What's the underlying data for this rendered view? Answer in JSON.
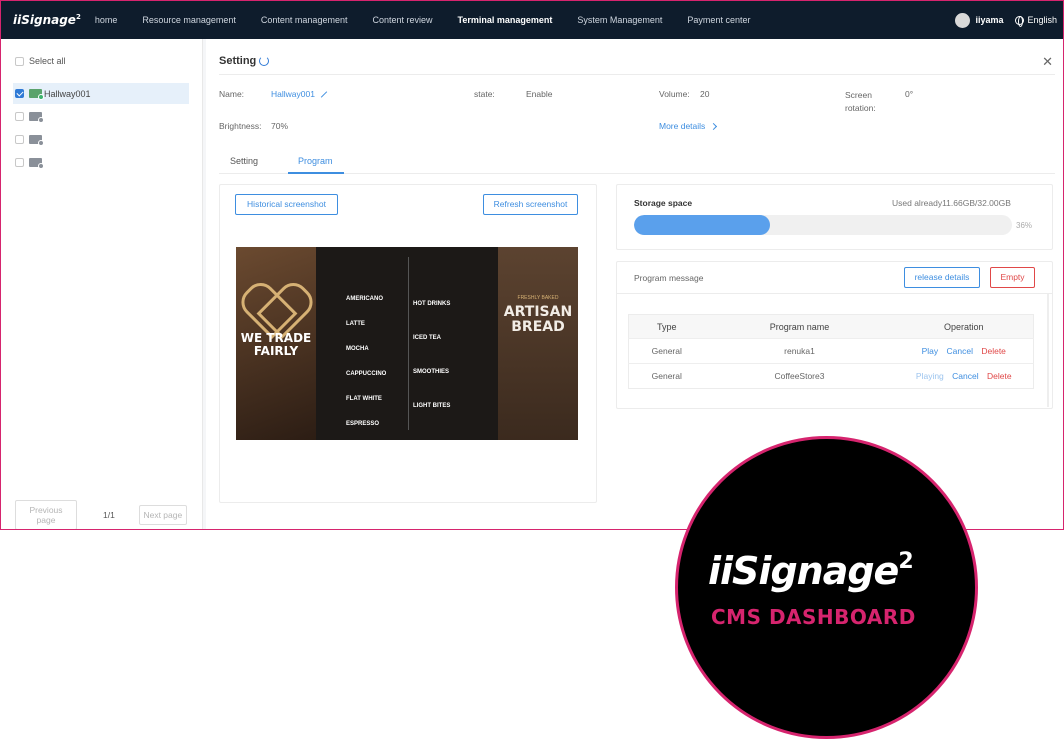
{
  "header": {
    "logo": "iiSignage",
    "logo_sup": "2",
    "nav": [
      {
        "label": "home",
        "active": false
      },
      {
        "label": "Resource management",
        "active": false
      },
      {
        "label": "Content management",
        "active": false
      },
      {
        "label": "Content review",
        "active": false
      },
      {
        "label": "Terminal management",
        "active": true
      },
      {
        "label": "System Management",
        "active": false
      },
      {
        "label": "Payment center",
        "active": false
      }
    ],
    "user": "iiyama",
    "language": "English"
  },
  "sidebar": {
    "select_all": "Select all",
    "terminals": [
      {
        "name": "Hallway001",
        "checked": true,
        "online": true
      },
      {
        "name": "",
        "checked": false,
        "online": false
      },
      {
        "name": "",
        "checked": false,
        "online": false
      },
      {
        "name": "",
        "checked": false,
        "online": false
      }
    ],
    "pager": {
      "prev": "Previous page",
      "page": "1/1",
      "next": "Next page"
    }
  },
  "detail": {
    "title": "Setting",
    "name_label": "Name:",
    "name_value": "Hallway001",
    "state_label": "state:",
    "state_value": "Enable",
    "volume_label": "Volume:",
    "volume_value": "20",
    "rotation_label": "Screen rotation:",
    "rotation_value": "0°",
    "brightness_label": "Brightness:",
    "brightness_value": "70%",
    "more_details": "More details",
    "tabs": [
      {
        "label": "Setting",
        "active": false
      },
      {
        "label": "Program",
        "active": true
      }
    ]
  },
  "screenshot": {
    "historical": "Historical screenshot",
    "refresh": "Refresh screenshot",
    "preview": {
      "left_text": "WE TRADE FAIRLY",
      "menu_col1": [
        "AMERICANO",
        "LATTE",
        "MOCHA",
        "CAPPUCCINO",
        "FLAT WHITE",
        "ESPRESSO"
      ],
      "menu_col2": [
        "HOT DRINKS",
        "ICED TEA",
        "SMOOTHIES",
        "LIGHT BITES"
      ],
      "right_small": "FRESHLY BAKED",
      "right_text": "ARTISAN BREAD"
    }
  },
  "storage": {
    "title": "Storage space",
    "used": "Used already11.66GB/32.00GB",
    "percent_label": "36%",
    "percent": 36
  },
  "program_message": {
    "title": "Program message",
    "release_details": "release details",
    "empty": "Empty",
    "columns": [
      "Type",
      "Program name",
      "Operation"
    ],
    "rows": [
      {
        "type": "General",
        "name": "renuka1",
        "name_link": false,
        "play": "Play",
        "play_state": "active",
        "cancel": "Cancel",
        "delete": "Delete"
      },
      {
        "type": "General",
        "name": "CoffeeStore3",
        "name_link": true,
        "play": "Playing",
        "play_state": "muted",
        "cancel": "Cancel",
        "delete": "Delete"
      }
    ]
  },
  "badge": {
    "logo": "iiSignage",
    "logo_sup": "2",
    "subtitle": "CMS DASHBOARD"
  },
  "colors": {
    "accent": "#3e8ee0",
    "brand": "#d6246e",
    "topbar": "#0e1c2c",
    "danger": "#e04848"
  }
}
